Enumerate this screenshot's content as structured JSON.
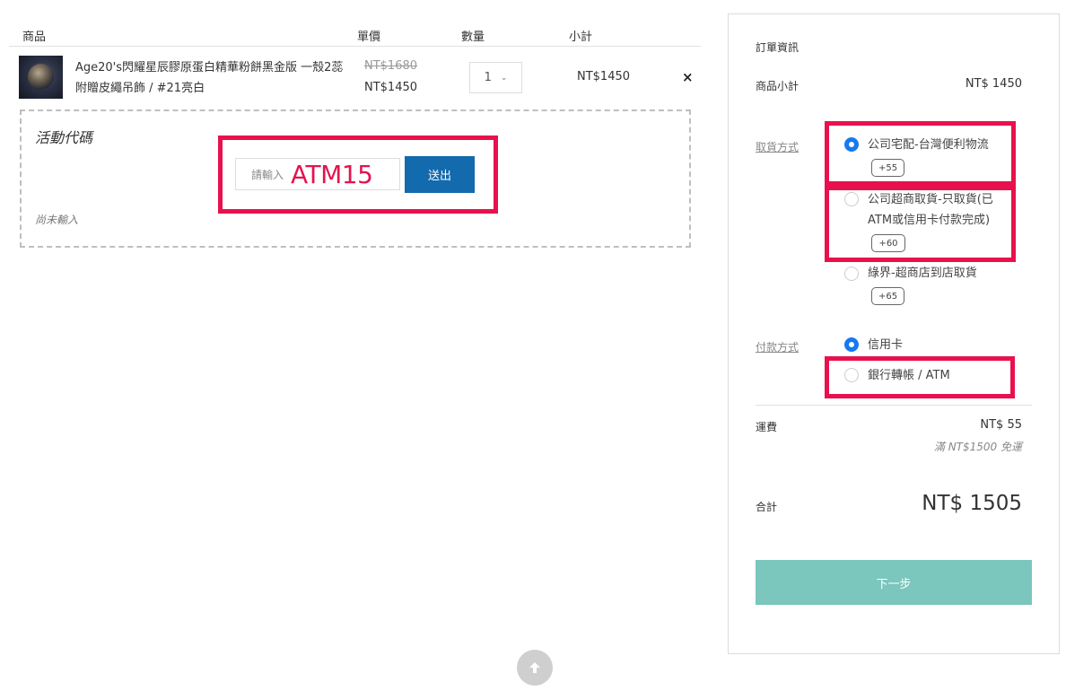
{
  "cart": {
    "headers": {
      "product": "商品",
      "unit_price": "單價",
      "quantity": "數量",
      "subtotal": "小計"
    },
    "item": {
      "name": "Age20's閃耀星辰膠原蛋白精華粉餅黑金版 一殼2蕊附贈皮繩吊飾 / #21亮白",
      "price_original": "NT$1680",
      "price_sale": "NT$1450",
      "quantity": "1",
      "subtotal": "NT$1450",
      "remove_icon": "×"
    }
  },
  "promo": {
    "title": "活動代碼",
    "placeholder": "請輸入",
    "value": "ATM15",
    "submit_label": "送出",
    "status": "尚未輸入"
  },
  "summary": {
    "title": "訂單資訊",
    "product_subtotal_label": "商品小計",
    "product_subtotal_value": "NT$ 1450",
    "shipping_method_label": "取貨方式",
    "shipping_options": [
      {
        "line1": "公司宅配-台灣便利物流",
        "line2": "",
        "fee": "+55",
        "selected": true
      },
      {
        "line1": "公司超商取貨-只取貨(已",
        "line2": "ATM或信用卡付款完成)",
        "fee": "+60",
        "selected": false
      },
      {
        "line1": "綠界-超商店到店取貨",
        "line2": "",
        "fee": "+65",
        "selected": false
      }
    ],
    "payment_method_label": "付款方式",
    "payment_options": [
      {
        "label": "信用卡",
        "selected": true
      },
      {
        "label": "銀行轉帳 / ATM",
        "selected": false
      }
    ],
    "shipping_fee_label": "運費",
    "shipping_fee_value": "NT$ 55",
    "free_shipping_note": "滿 NT$1500 免運",
    "total_label": "合計",
    "total_value": "NT$ 1505",
    "next_label": "下一步"
  },
  "colors": {
    "accent_blue": "#136aad",
    "radio_blue": "#1579f2",
    "next_button": "#7bc6bd",
    "highlight_red": "#e8114e"
  },
  "icons": {
    "scroll_top": "arrow-up-icon",
    "remove": "close-icon"
  }
}
